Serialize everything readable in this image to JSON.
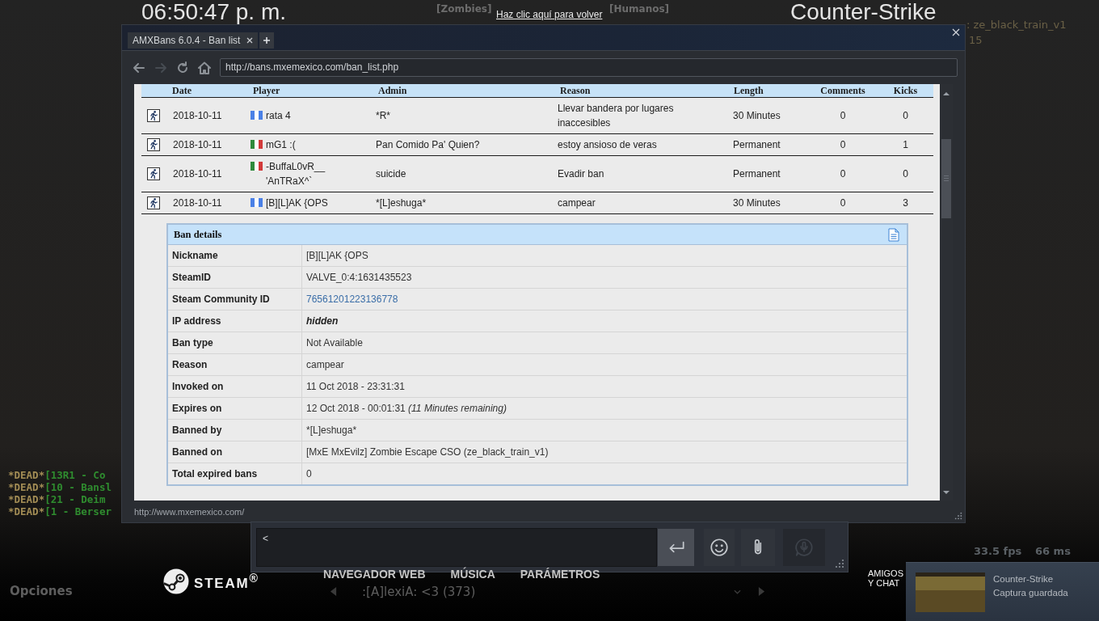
{
  "game_hud": {
    "clock": "06:50:47 p. m.",
    "title": "Counter-Strike",
    "teams": [
      "[Zombies]",
      "[Humanos]"
    ],
    "map": ": ze_black_train_v1",
    "map_detail": "15",
    "chat": [
      {
        "tag": "*DEAD*",
        "text": "[13R1 - Co"
      },
      {
        "tag": "*DEAD*",
        "text": "[10 - Bansl"
      },
      {
        "tag": "*DEAD*",
        "text": "[21 - Deim"
      },
      {
        "tag": "*DEAD*",
        "text": "[1 - Berser"
      }
    ],
    "options": "Opciones",
    "spectating": ":[A]lexiA: <3 (373)",
    "fps": "33.5 fps",
    "ping": "66 ms"
  },
  "overlay": {
    "return_link": "Haz clic aquí para volver"
  },
  "browser": {
    "tabs": [
      {
        "label": "AMXBans 6.0.4 - Ban list",
        "selected": true
      }
    ],
    "nav_buttons": [
      {
        "kind": "back",
        "disabled": false
      },
      {
        "kind": "forward",
        "disabled": true
      },
      {
        "kind": "reload",
        "disabled": false
      },
      {
        "kind": "home",
        "disabled": false
      }
    ],
    "url": "http://bans.mxemexico.com/ban_list.php",
    "table": {
      "columns": [
        "Date",
        "Player",
        "Admin",
        "Reason",
        "Length",
        "Comments",
        "Kicks"
      ],
      "rows": [
        {
          "date": "2018-10-11",
          "flag": [
            {
              "color": "#4a80e6"
            },
            {
              "color": "#ffffff"
            },
            {
              "color": "#4a80e6"
            }
          ],
          "player": "rata 4",
          "admin": "*R*",
          "reason": "Llevar bandera por lugares inaccesibles",
          "length": "30 Minutes",
          "comments": "0",
          "kicks": "0"
        },
        {
          "date": "2018-10-11",
          "flag": [
            {
              "color": "#2f8a3c"
            },
            {
              "color": "#ffffff"
            },
            {
              "color": "#d23a3a"
            }
          ],
          "player": "mG1 :(",
          "admin": "Pan Comido Pa' Quien?",
          "reason": "estoy ansioso de veras",
          "length": "Permanent",
          "comments": "0",
          "kicks": "1"
        },
        {
          "date": "2018-10-11",
          "flag": [
            {
              "color": "#2f8a3c"
            },
            {
              "color": "#ffffff"
            },
            {
              "color": "#d23a3a"
            }
          ],
          "player": "-BuffaL0vR__ 'AnTRaX^`",
          "admin": "suicide",
          "reason": "Evadir ban",
          "length": "Permanent",
          "comments": "0",
          "kicks": "0"
        },
        {
          "date": "2018-10-11",
          "flag": [
            {
              "color": "#4a80e6"
            },
            {
              "color": "#ffffff"
            },
            {
              "color": "#4a80e6"
            }
          ],
          "player": "[B][L]AK {OPS",
          "admin": "*[L]eshuga*",
          "reason": "campear",
          "length": "30 Minutes",
          "comments": "0",
          "kicks": "3"
        }
      ]
    },
    "ban_details": {
      "title": "Ban details",
      "fields": [
        {
          "label": "Nickname",
          "value": "[B][L]AK {OPS",
          "kind": "text"
        },
        {
          "label": "SteamID",
          "value": "VALVE_0:4:1631435523",
          "kind": "text"
        },
        {
          "label": "Steam Community ID",
          "value": "76561201223136778",
          "kind": "link"
        },
        {
          "label": "IP address",
          "value": "hidden",
          "kind": "strong"
        },
        {
          "label": "Ban type",
          "value": "Not Available",
          "kind": "text"
        },
        {
          "label": "Reason",
          "value": "campear",
          "kind": "text"
        },
        {
          "label": "Invoked on",
          "value": "11 Oct 2018 - 23:31:31",
          "kind": "text"
        },
        {
          "label": "Expires on",
          "value": "12 Oct 2018 - 00:01:31 *(11 Minutes remaining)*",
          "kind": "rich"
        },
        {
          "label": "Banned by",
          "value": "*[L]eshuga*",
          "kind": "text"
        },
        {
          "label": "Banned on",
          "value": "[MxE MxEvilz] Zombie Escape CSO (ze_black_train_v1)",
          "kind": "text"
        },
        {
          "label": "Total expired bans",
          "value": "0",
          "kind": "text"
        }
      ]
    },
    "status_url": "http://www.mxemexico.com/"
  },
  "chat_window": {
    "message": "<",
    "buttons": [
      {
        "kind": "send",
        "disabled": false
      },
      {
        "kind": "emoji",
        "disabled": false
      },
      {
        "kind": "attach",
        "disabled": false
      },
      {
        "kind": "voice",
        "disabled": true
      }
    ]
  },
  "steam_bar": {
    "logo": "STEAM$^{®}$",
    "nav": [
      "NAVEGADOR WEB",
      "MÚSICA",
      "PARÁMETROS"
    ],
    "friends": "AMIGOS Y CHAT"
  },
  "notification": {
    "title": "Counter-Strike",
    "message": "Captura guardada"
  }
}
